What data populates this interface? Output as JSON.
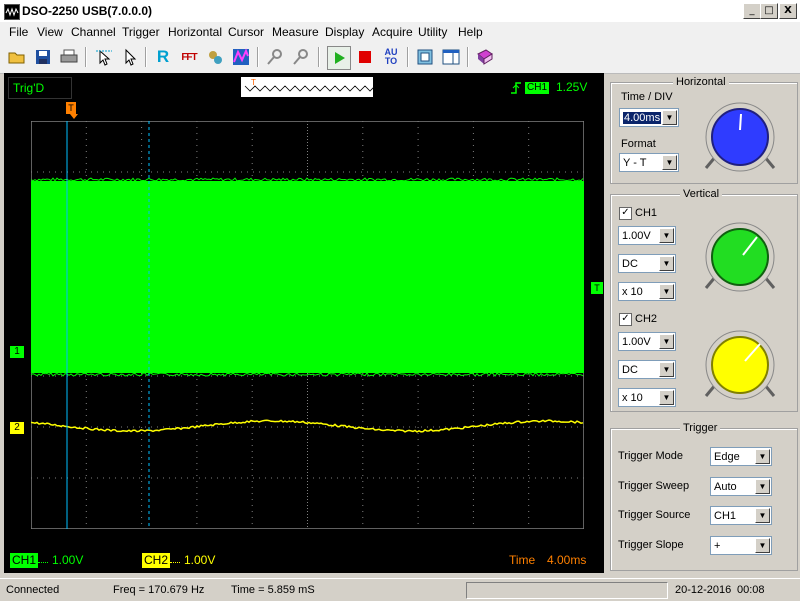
{
  "window": {
    "title": "DSO-2250 USB(7.0.0.0)",
    "minimize": "_",
    "maximize": "□",
    "close": "X"
  },
  "menu": [
    {
      "label": "File"
    },
    {
      "label": "View"
    },
    {
      "label": "Channel"
    },
    {
      "label": "Trigger"
    },
    {
      "label": "Horizontal"
    },
    {
      "label": "Cursor"
    },
    {
      "label": "Measure"
    },
    {
      "label": "Display"
    },
    {
      "label": "Acquire"
    },
    {
      "label": "Utility"
    },
    {
      "label": "Help"
    }
  ],
  "toolbar": {
    "auto_label": "AU\nTO",
    "r_label": "R",
    "fft_label": "FFT"
  },
  "scope": {
    "trig_status": "Trig'D",
    "trigger_channel": "CH1",
    "trigger_level": "1.25V",
    "ch1_marker": "1",
    "ch2_marker": "2",
    "trigger_marker": "T",
    "time_marker": "T",
    "bottom": {
      "ch1_label": "CH1",
      "ch1_value": "1.00V",
      "ch2_label": "CH2",
      "ch2_value": "1.00V",
      "time_label": "Time",
      "time_value": "4.00ms"
    },
    "colors": {
      "ch1": "#00ff00",
      "ch2": "#ffff00",
      "cursor": "#00bfff",
      "background": "#000000",
      "grid": "#808080"
    }
  },
  "horizontal": {
    "title": "Horizontal",
    "time_div_label": "Time / DIV",
    "time_div_value": "4.00ms",
    "format_label": "Format",
    "format_value": "Y - T",
    "knob_color": "#2f3cff"
  },
  "vertical": {
    "title": "Vertical",
    "ch1": {
      "label": "CH1",
      "checked": true,
      "volts": "1.00V",
      "coupling": "DC",
      "probe": "x 10",
      "knob_color": "#22dd22"
    },
    "ch2": {
      "label": "CH2",
      "checked": true,
      "volts": "1.00V",
      "coupling": "DC",
      "probe": "x 10",
      "knob_color": "#ffff00"
    }
  },
  "trigger": {
    "title": "Trigger",
    "rows": [
      {
        "label": "Trigger Mode",
        "value": "Edge"
      },
      {
        "label": "Trigger Sweep",
        "value": "Auto"
      },
      {
        "label": "Trigger Source",
        "value": "CH1"
      },
      {
        "label": "Trigger Slope",
        "value": "+"
      }
    ]
  },
  "statusbar": {
    "connection": "Connected",
    "freq": "Freq = 170.679 Hz",
    "time": "Time = 5.859 mS",
    "date": "20-12-2016",
    "clock": "00:08"
  }
}
